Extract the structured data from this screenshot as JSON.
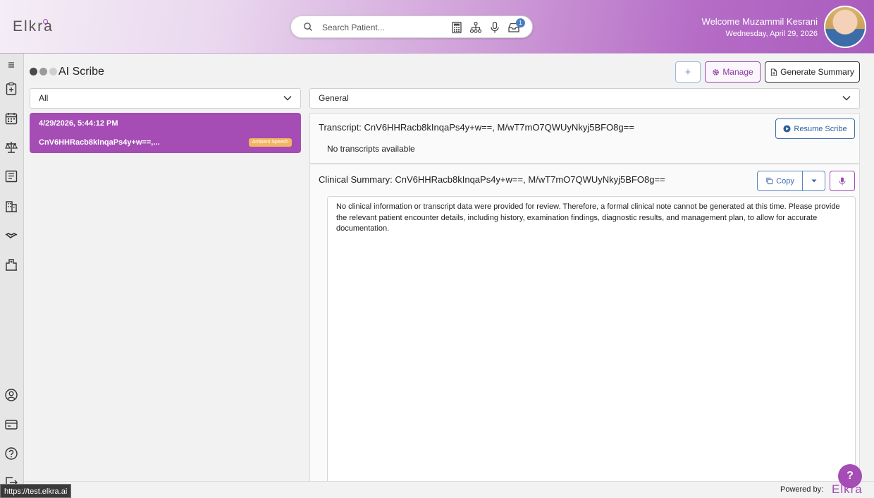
{
  "app": {
    "logo_text": "Elkra"
  },
  "header": {
    "search_placeholder": "Search Patient...",
    "inbox_count": "1",
    "welcome": "Welcome Muzammil Kesrani",
    "date": "Wednesday, April 29, 2026"
  },
  "sidebar": {
    "icons": [
      "menu-icon",
      "clipboard-icon",
      "calendar-icon",
      "scales-icon",
      "document-icon",
      "building-icon",
      "handshake-icon",
      "hospital-icon",
      "user-circle-icon",
      "card-icon",
      "help-icon",
      "logout-icon"
    ]
  },
  "page": {
    "title": "AI Scribe",
    "add_label": "+",
    "manage_label": "Manage",
    "generate_label": "Generate Summary",
    "filter_selected": "All",
    "template_selected": "General"
  },
  "session": {
    "datetime": "4/29/2026, 5:44:12 PM",
    "id": "CnV6HHRacb8kInqaPs4y+w==,...",
    "tag": "Ambient Speech"
  },
  "transcript": {
    "title": "Transcript: CnV6HHRacb8kInqaPs4y+w==, M/wT7mO7QWUyNkyj5BFO8g==",
    "empty_text": "No transcripts available",
    "resume_label": "Resume Scribe"
  },
  "summary": {
    "title": "Clinical Summary: CnV6HHRacb8kInqaPs4y+w==, M/wT7mO7QWUyNkyj5BFO8g==",
    "copy_label": "Copy",
    "body": "No clinical information or transcript data were provided for review. Therefore, a formal clinical note cannot be generated at this time. Please provide the relevant patient encounter details, including history, examination findings, diagnostic results, and management plan, to allow for accurate documentation."
  },
  "footer": {
    "url": "https://test.elkra.ai",
    "left_fragment": "ra",
    "powered_by": "Powered by:",
    "brand": "Elkra",
    "help": "?"
  },
  "colors": {
    "accent": "#a54cb5",
    "blue": "#3b6ea8",
    "tag": "#f4b563"
  }
}
